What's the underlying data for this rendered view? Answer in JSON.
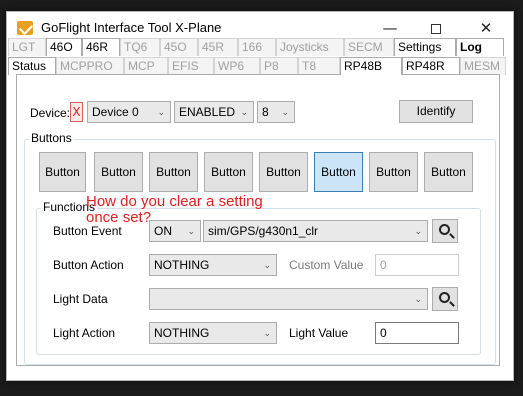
{
  "window": {
    "title": "GoFlight Interface Tool X-Plane",
    "minimize": "—",
    "close": "✕"
  },
  "tabs_row1": [
    {
      "label": "LGT",
      "state": "off"
    },
    {
      "label": "46O",
      "state": "on"
    },
    {
      "label": "46R",
      "state": "on"
    },
    {
      "label": "TQ6",
      "state": "off"
    },
    {
      "label": "45O",
      "state": "off"
    },
    {
      "label": "45R",
      "state": "off"
    },
    {
      "label": "166",
      "state": "off"
    },
    {
      "label": "Joysticks",
      "state": "off"
    },
    {
      "label": "SECM",
      "state": "off"
    },
    {
      "label": "Settings",
      "state": "on"
    },
    {
      "label": "Log",
      "state": "bold"
    }
  ],
  "tabs_row2": [
    {
      "label": "Status",
      "state": "on"
    },
    {
      "label": "MCPPRO",
      "state": "off"
    },
    {
      "label": "MCP",
      "state": "off"
    },
    {
      "label": "EFIS",
      "state": "off"
    },
    {
      "label": "WP6",
      "state": "off"
    },
    {
      "label": "P8",
      "state": "off"
    },
    {
      "label": "T8",
      "state": "off"
    },
    {
      "label": "RP48B",
      "state": "active"
    },
    {
      "label": "RP48R",
      "state": "on"
    },
    {
      "label": "MESM",
      "state": "off"
    }
  ],
  "device": {
    "label": "Device:",
    "remove": "X",
    "selected": "Device 0",
    "status": "ENABLED",
    "count": "8",
    "identify": "Identify"
  },
  "buttons_group": {
    "label": "Buttons",
    "buttons": [
      "Button",
      "Button",
      "Button",
      "Button",
      "Button",
      "Button",
      "Button",
      "Button"
    ],
    "selected_index": 5
  },
  "functions": {
    "label": "Functions",
    "button_event_label": "Button Event",
    "button_event_state": "ON",
    "button_event_value": "sim/GPS/g430n1_clr",
    "button_action_label": "Button Action",
    "button_action_value": "NOTHING",
    "custom_value_label": "Custom Value",
    "custom_value": "0",
    "light_data_label": "Light Data",
    "light_data_value": "",
    "light_action_label": "Light Action",
    "light_action_value": "NOTHING",
    "light_value_label": "Light Value",
    "light_value": "0"
  },
  "annotation": {
    "line1": "How do you clear a setting",
    "line2": "once set?"
  },
  "colors": {
    "selected_button": "#cce4f7",
    "annotation": "#e02020"
  }
}
